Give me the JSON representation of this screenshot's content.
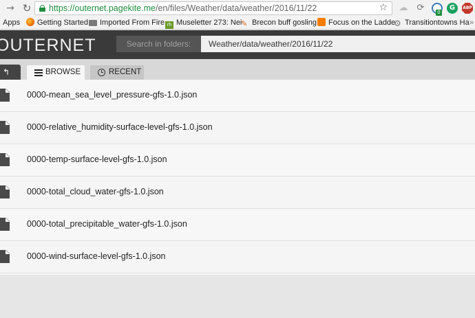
{
  "browser": {
    "url_host": "https://outernet.pagekite.me",
    "url_path": "/en/files/Weather/data/weather/2016/11/22",
    "forward_icon": "arrow-right-icon",
    "reload_icon": "reload-icon",
    "extensions": {
      "blue_badge": "0",
      "green_label": "G",
      "abp_label": "ABP"
    }
  },
  "bookmarks": [
    {
      "label": "Apps",
      "icon": "apps-icon"
    },
    {
      "label": "Getting Started",
      "icon": "firefox-icon"
    },
    {
      "label": "Imported From Fire",
      "icon": "folder-icon"
    },
    {
      "label": "Museletter 273: Nei",
      "icon": "rh-icon",
      "icon_text": "rh"
    },
    {
      "label": "Brecon buff gosling",
      "icon": "feather-icon"
    },
    {
      "label": "Focus on the Ladde",
      "icon": "blogger-icon"
    },
    {
      "label": "Transitiontowns Ha",
      "icon": "gear-icon"
    }
  ],
  "bookmarks_more": "»",
  "header": {
    "logo": "OUTERNET",
    "search_label": "Search in folders:",
    "search_value": "Weather/data/weather/2016/11/22"
  },
  "tabs": [
    {
      "label": "BROWSE",
      "icon": "list-icon",
      "active": true
    },
    {
      "label": "RECENT",
      "icon": "clock-icon",
      "active": false
    }
  ],
  "files": [
    "0000-mean_sea_level_pressure-gfs-1.0.json",
    "0000-relative_humidity-surface-level-gfs-1.0.json",
    "0000-temp-surface-level-gfs-1.0.json",
    "0000-total_cloud_water-gfs-1.0.json",
    "0000-total_precipitable_water-gfs-1.0.json",
    "0000-wind-surface-level-gfs-1.0.json"
  ],
  "colors": {
    "header_bg": "#3a3a3a",
    "secure_green": "#1e8e3e",
    "list_bg": "#f7f7f7"
  }
}
